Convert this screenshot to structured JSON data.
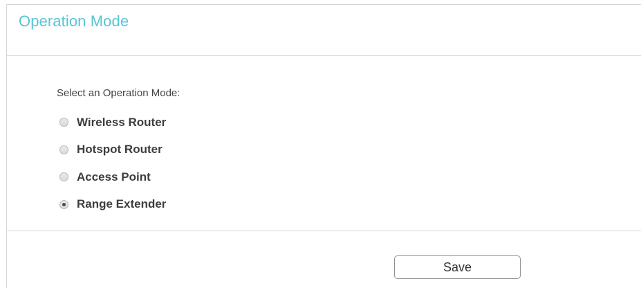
{
  "section": {
    "title": "Operation Mode"
  },
  "form": {
    "prompt": "Select an Operation Mode:",
    "options": [
      {
        "label": "Wireless Router",
        "checked": false
      },
      {
        "label": "Hotspot Router",
        "checked": false
      },
      {
        "label": "Access Point",
        "checked": false
      },
      {
        "label": "Range Extender",
        "checked": true
      }
    ],
    "selected": "Range Extender"
  },
  "actions": {
    "save_label": "Save"
  },
  "colors": {
    "title": "#57c5d6",
    "divider": "#d6d6d6",
    "text": "#3d3d3d"
  }
}
